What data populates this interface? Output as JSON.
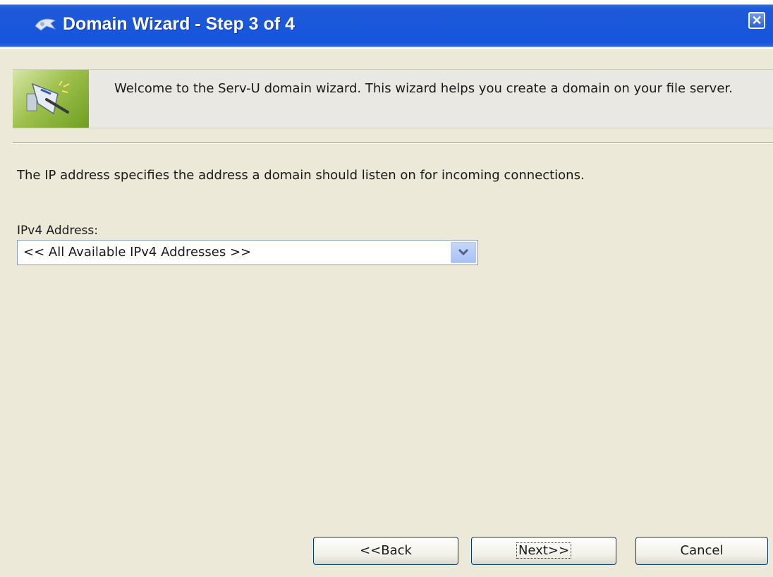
{
  "window": {
    "title": "Domain Wizard - Step 3 of 4",
    "title_icon": "wizard-app-icon",
    "close_icon": "close-icon",
    "close_glyph": "✕"
  },
  "banner": {
    "icon": "network-wizard-icon",
    "text": "Welcome to the Serv-U domain wizard. This wizard helps you create a domain on your file server."
  },
  "content": {
    "description": "The IP address specifies the address a domain should listen on for incoming connections.",
    "ipv4_label": "IPv4 Address:",
    "ipv4_select": {
      "selected": "<< All Available IPv4 Addresses >>",
      "arrow_icon": "chevron-down-icon"
    }
  },
  "buttons": {
    "back": "<<Back",
    "next": "Next>>",
    "cancel": "Cancel"
  },
  "colors": {
    "title_bar": "#1555dd",
    "dialog_bg": "#ece9d8",
    "banner_green": "#9fc14e"
  }
}
